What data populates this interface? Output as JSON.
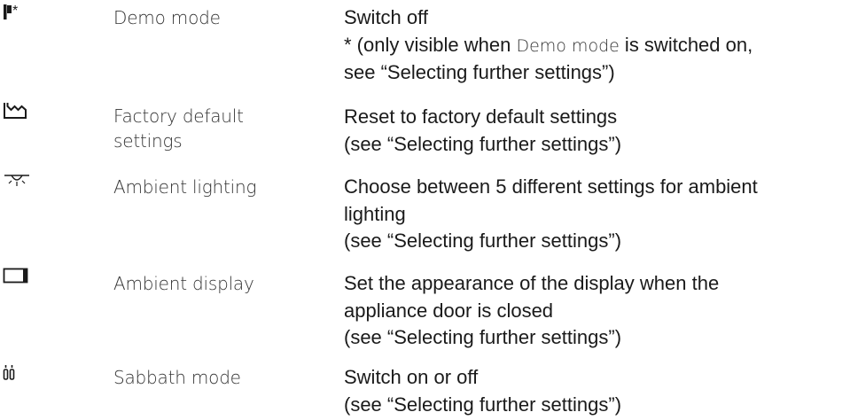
{
  "rows": [
    {
      "name": [
        "Demo mode"
      ],
      "icon": "demo-mode-icon",
      "desc": {
        "line1": "Switch off",
        "line2_prefix": "* (only visible when ",
        "line2_mode": "Demo mode",
        "line2_suffix": " is switched on,",
        "line3": "see “Selecting further settings”)"
      }
    },
    {
      "name": [
        "Factory default",
        "settings"
      ],
      "icon": "factory-icon",
      "desc": {
        "line1": "Reset to factory default settings",
        "line2": "(see “Selecting further settings”)"
      }
    },
    {
      "name": [
        "Ambient lighting"
      ],
      "icon": "ambient-lighting-icon",
      "desc": {
        "line1": "Choose between 5 different settings for ambient",
        "line2": "lighting",
        "line3": "(see “Selecting further settings”)"
      }
    },
    {
      "name": [
        "Ambient display"
      ],
      "icon": "ambient-display-icon",
      "desc": {
        "line1": "Set the appearance of the display when the",
        "line2": "appliance door is closed",
        "line3": "(see “Selecting further settings”)"
      }
    },
    {
      "name": [
        "Sabbath mode"
      ],
      "icon": "sabbath-mode-icon",
      "desc": {
        "line1": "Switch on or off",
        "line2": "(see “Selecting further settings”)"
      }
    }
  ]
}
